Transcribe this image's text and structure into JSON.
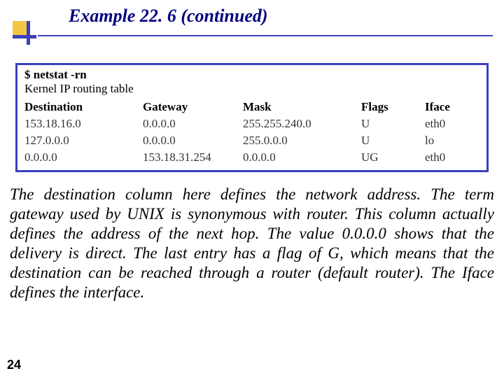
{
  "title": "Example 22. 6 (continued)",
  "terminal": {
    "command": "$ netstat -rn",
    "caption": "Kernel IP routing table",
    "headers": {
      "destination": "Destination",
      "gateway": "Gateway",
      "mask": "Mask",
      "flags": "Flags",
      "iface": "Iface"
    },
    "rows": [
      {
        "destination": "153.18.16.0",
        "gateway": "0.0.0.0",
        "mask": "255.255.240.0",
        "flags": "U",
        "iface": "eth0"
      },
      {
        "destination": "127.0.0.0",
        "gateway": "0.0.0.0",
        "mask": "255.0.0.0",
        "flags": "U",
        "iface": "lo"
      },
      {
        "destination": "0.0.0.0",
        "gateway": "153.18.31.254",
        "mask": "0.0.0.0",
        "flags": "UG",
        "iface": "eth0"
      }
    ]
  },
  "paragraph": "The destination column here defines the network address. The term gateway used by UNIX is synonymous with router. This column actually defines the address of the next hop. The value 0.0.0.0 shows that the delivery is direct. The last entry has a flag of G, which means that the destination can be reached through a router (default router). The Iface defines the interface.",
  "page_number": "24"
}
